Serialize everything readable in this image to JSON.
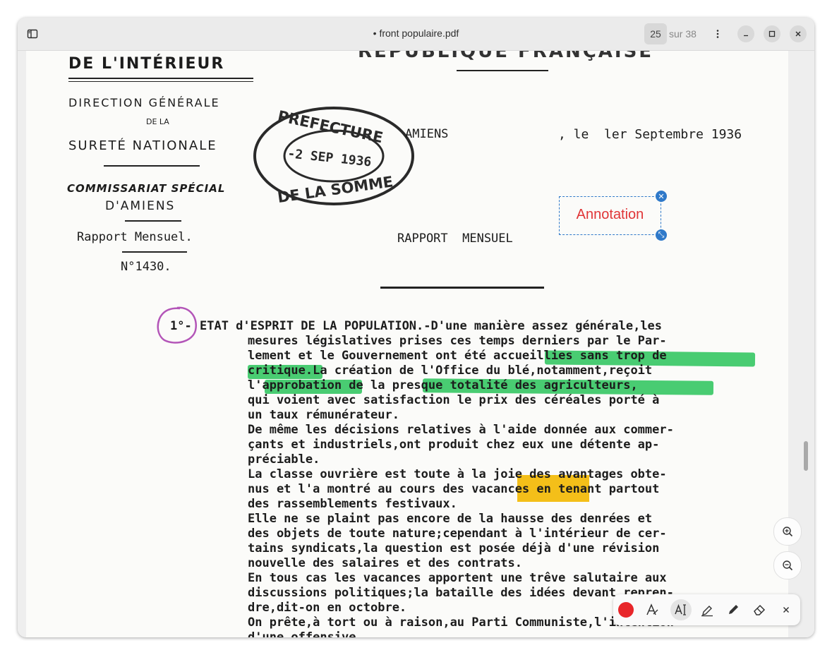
{
  "window": {
    "title": "• front populaire.pdf",
    "current_page": "25",
    "page_total": "sur 38"
  },
  "document": {
    "header_left": {
      "ministry": "DE L'INTÉRIEUR",
      "direction": "DIRECTION GÉNÉRALE",
      "de_la": "DE LA",
      "surete": "SURETÉ NATIONALE",
      "commissariat": "COMMISSARIAT SPÉCIAL",
      "city": "D'AMIENS",
      "report_type": "Rapport Mensuel.",
      "report_number": "N°1430."
    },
    "header_top": "RÉPUBLIQUE FRANÇAISE",
    "stamp": {
      "top": "PREFECTURE",
      "date": "-2 SEP 1936",
      "bottom": "DE LA SOMME"
    },
    "place": "AMIENS",
    "date_line": ", le  ler Septembre 1936",
    "report_title": "RAPPORT  MENSUEL",
    "section_number": "1°-",
    "lines": [
      "ETAT d'ESPRIT DE LA POPULATION.-D'une manière assez générale,les",
      "mesures législatives prises ces temps derniers par le Par-",
      "lement et le Gouvernement ont été accueillies sans trop de",
      "critique.La création de l'Office du blé,notamment,reçoit",
      "l'approbation de la presque totalité des agriculteurs,",
      "qui voient avec satisfaction le prix des céréales porté à",
      "un taux rémunérateur.",
      "De même les décisions relatives à l'aide donnée aux commer-",
      "çants et industriels,ont produit chez eux une détente ap-",
      "préciable.",
      "La classe ouvrière est toute à la joie des avantages obte-",
      "nus et l'a montré au cours des vacances en tenant partout",
      "des rassemblements festivaux.",
      "Elle ne se plaint pas encore de la hausse des denrées et",
      "des objets de toute nature;cependant à l'intérieur de cer-",
      "tains syndicats,la question est posée déjà d'une révision",
      "nouvelle des salaires et des contrats.",
      "En tous cas les vacances apportent une trêve salutaire aux",
      "discussions politiques;la bataille des idées devant repren-",
      "dre,dit-on en octobre.",
      "On prête,à tort ou à raison,au Parti Communiste,l'intention",
      "d'une offensive"
    ]
  },
  "annotation": {
    "text": "Annotation"
  },
  "toolbar": {
    "color": "#e8262a",
    "tools": [
      "text-style-icon",
      "text-select-icon",
      "highlight-icon",
      "pen-icon",
      "eraser-icon",
      "close-icon"
    ]
  },
  "colors": {
    "highlight_green": "#29c35a",
    "highlight_yellow": "#f3b800",
    "circle": "#b355b8",
    "annotation_border": "#2f79c9",
    "annotation_text": "#e03537"
  }
}
